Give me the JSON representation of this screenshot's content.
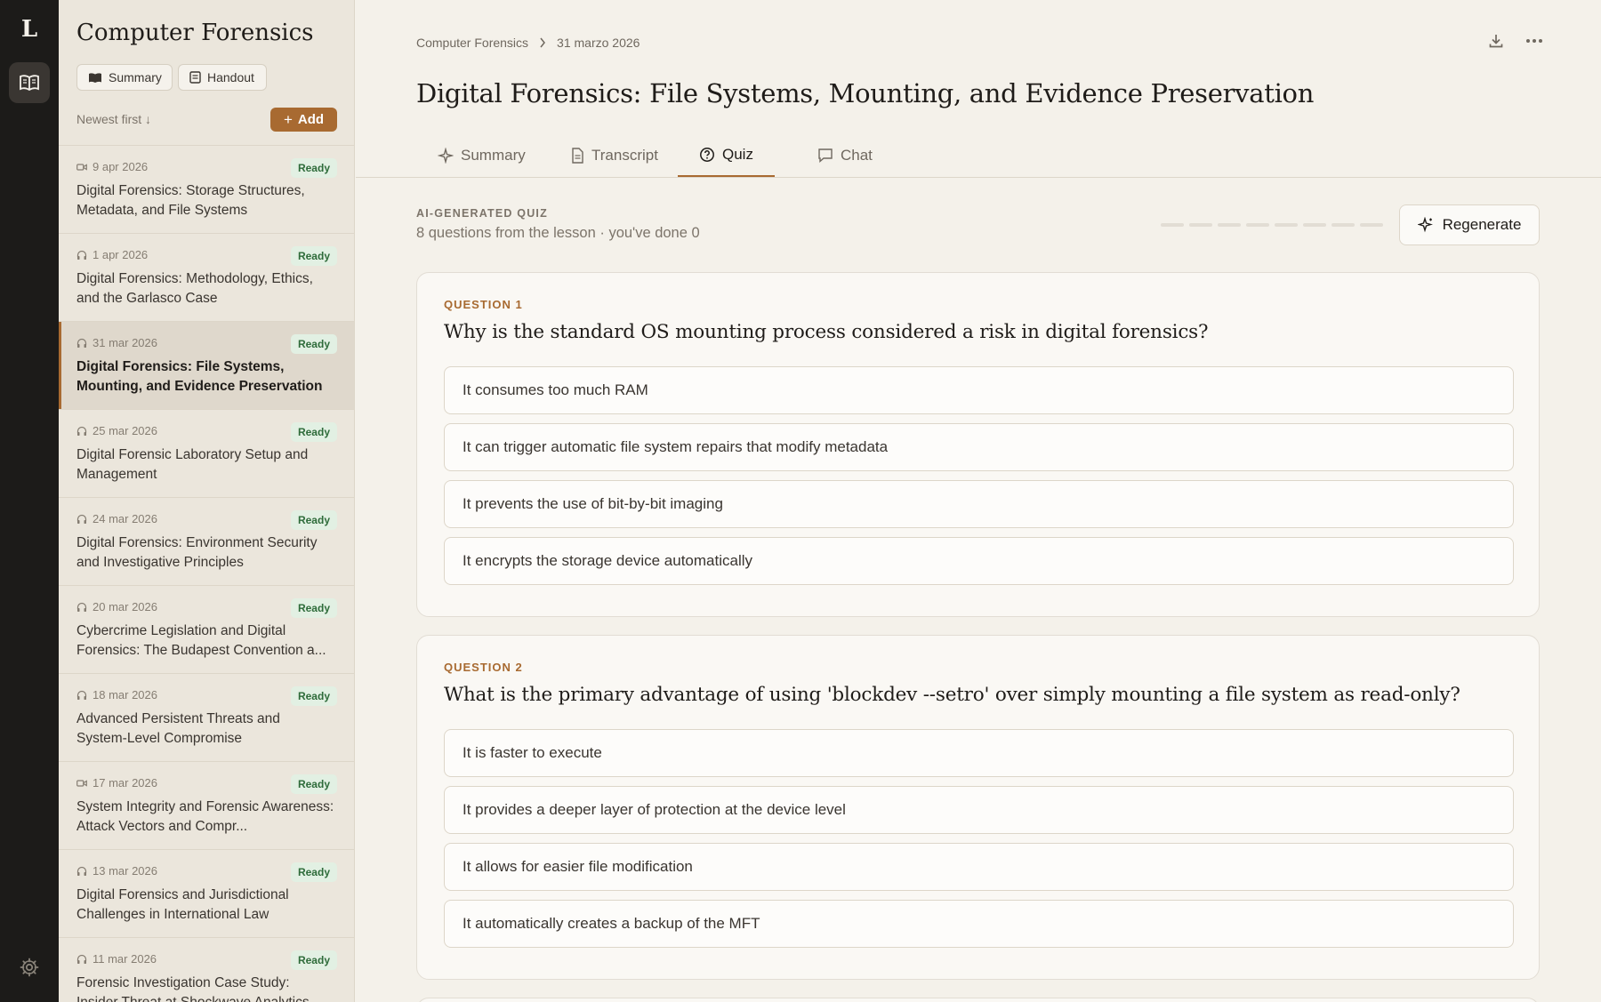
{
  "rail": {
    "logo": "L",
    "icons": [
      "book-icon",
      "gear-icon"
    ]
  },
  "sidebar": {
    "title": "Computer Forensics",
    "summary_btn": "Summary",
    "handout_btn": "Handout",
    "sort_label": "Newest first ↓",
    "add_label": "Add",
    "lessons": [
      {
        "date": "9 apr 2026",
        "media": "video-icon",
        "status": "Ready",
        "title": "Digital Forensics: Storage Structures, Metadata, and File Systems"
      },
      {
        "date": "1 apr 2026",
        "media": "headphones-icon",
        "status": "Ready",
        "title": "Digital Forensics: Methodology, Ethics, and the Garlasco Case"
      },
      {
        "date": "31 mar 2026",
        "media": "headphones-icon",
        "status": "Ready",
        "title": "Digital Forensics: File Systems, Mounting, and Evidence Preservation",
        "active": true
      },
      {
        "date": "25 mar 2026",
        "media": "headphones-icon",
        "status": "Ready",
        "title": "Digital Forensic Laboratory Setup and Management"
      },
      {
        "date": "24 mar 2026",
        "media": "headphones-icon",
        "status": "Ready",
        "title": "Digital Forensics: Environment Security and Investigative Principles"
      },
      {
        "date": "20 mar 2026",
        "media": "headphones-icon",
        "status": "Ready",
        "title": "Cybercrime Legislation and Digital Forensics: The Budapest Convention a..."
      },
      {
        "date": "18 mar 2026",
        "media": "headphones-icon",
        "status": "Ready",
        "title": "Advanced Persistent Threats and System-Level Compromise"
      },
      {
        "date": "17 mar 2026",
        "media": "video-icon",
        "status": "Ready",
        "title": "System Integrity and Forensic Awareness: Attack Vectors and Compr..."
      },
      {
        "date": "13 mar 2026",
        "media": "headphones-icon",
        "status": "Ready",
        "title": "Digital Forensics and Jurisdictional Challenges in International Law"
      },
      {
        "date": "11 mar 2026",
        "media": "headphones-icon",
        "status": "Ready",
        "title": "Forensic Investigation Case Study: Insider Threat at Shockwave Analytics"
      }
    ]
  },
  "main": {
    "breadcrumb": {
      "course": "Computer Forensics",
      "date": "31 marzo 2026"
    },
    "title": "Digital Forensics: File Systems, Mounting, and Evidence Preservation",
    "tabs": [
      {
        "label": "Summary",
        "icon": "sparkle-icon"
      },
      {
        "label": "Transcript",
        "icon": "document-icon"
      },
      {
        "label": "Quiz",
        "icon": "question-icon",
        "active": true
      },
      {
        "label": "Chat",
        "icon": "chat-icon"
      }
    ],
    "quiz": {
      "label": "AI-GENERATED QUIZ",
      "subtitle": "8 questions from the lesson · you've done 0",
      "progress_done": 0,
      "progress_total": 8,
      "regenerate_label": "Regenerate",
      "questions": [
        {
          "label": "QUESTION 1",
          "text": "Why is the standard OS mounting process considered a risk in digital forensics?",
          "options": [
            "It consumes too much RAM",
            "It can trigger automatic file system repairs that modify metadata",
            "It prevents the use of bit-by-bit imaging",
            "It encrypts the storage device automatically"
          ]
        },
        {
          "label": "QUESTION 2",
          "text": "What is the primary advantage of using 'blockdev --setro' over simply mounting a file system as read-only?",
          "options": [
            "It is faster to execute",
            "It provides a deeper layer of protection at the device level",
            "It allows for easier file modification",
            "It automatically creates a backup of the MFT"
          ]
        }
      ]
    }
  },
  "colors": {
    "accent": "#a86a31",
    "rail": "#1c1b19",
    "ready_bg": "#e2f0e3",
    "ready_text": "#2e6b3a"
  }
}
